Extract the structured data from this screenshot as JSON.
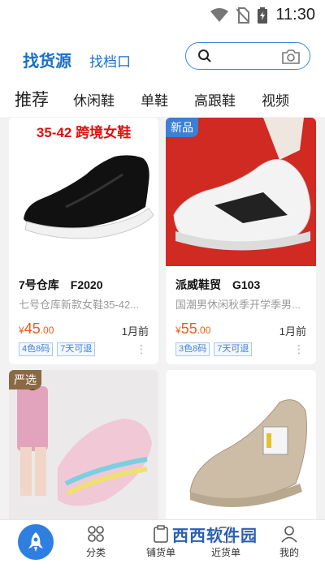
{
  "status": {
    "time": "11:30"
  },
  "header": {
    "tab_main": "找货源",
    "tab_second": "找档口"
  },
  "categories": [
    "推荐",
    "休闲鞋",
    "单鞋",
    "高跟鞋",
    "视频"
  ],
  "products": [
    {
      "banner_text": "35-42 跨境女鞋",
      "tag": "",
      "title": "7号仓库　F2020",
      "desc": "七号仓库新款女鞋35-42...",
      "price_currency": "¥",
      "price_int": "45",
      "price_dec": ".00",
      "time_ago": "1月前",
      "badges": [
        "4色8码",
        "7天可退"
      ]
    },
    {
      "banner_text": "",
      "tag": "新品",
      "title": "派威鞋贸　G103",
      "desc": "国潮男休闲秋季开学季男...",
      "price_currency": "¥",
      "price_int": "55",
      "price_dec": ".00",
      "time_ago": "1月前",
      "badges": [
        "3色8码",
        "7天可退"
      ]
    },
    {
      "tag": "严选"
    },
    {
      "tag": ""
    }
  ],
  "bottom_nav": [
    "分类",
    "铺货单",
    "近货单",
    "我的"
  ],
  "watermark": "西西软件园",
  "colors": {
    "accent": "#1a6fc9",
    "price": "#f05a1a",
    "nav_home": "#2f7fe0"
  }
}
